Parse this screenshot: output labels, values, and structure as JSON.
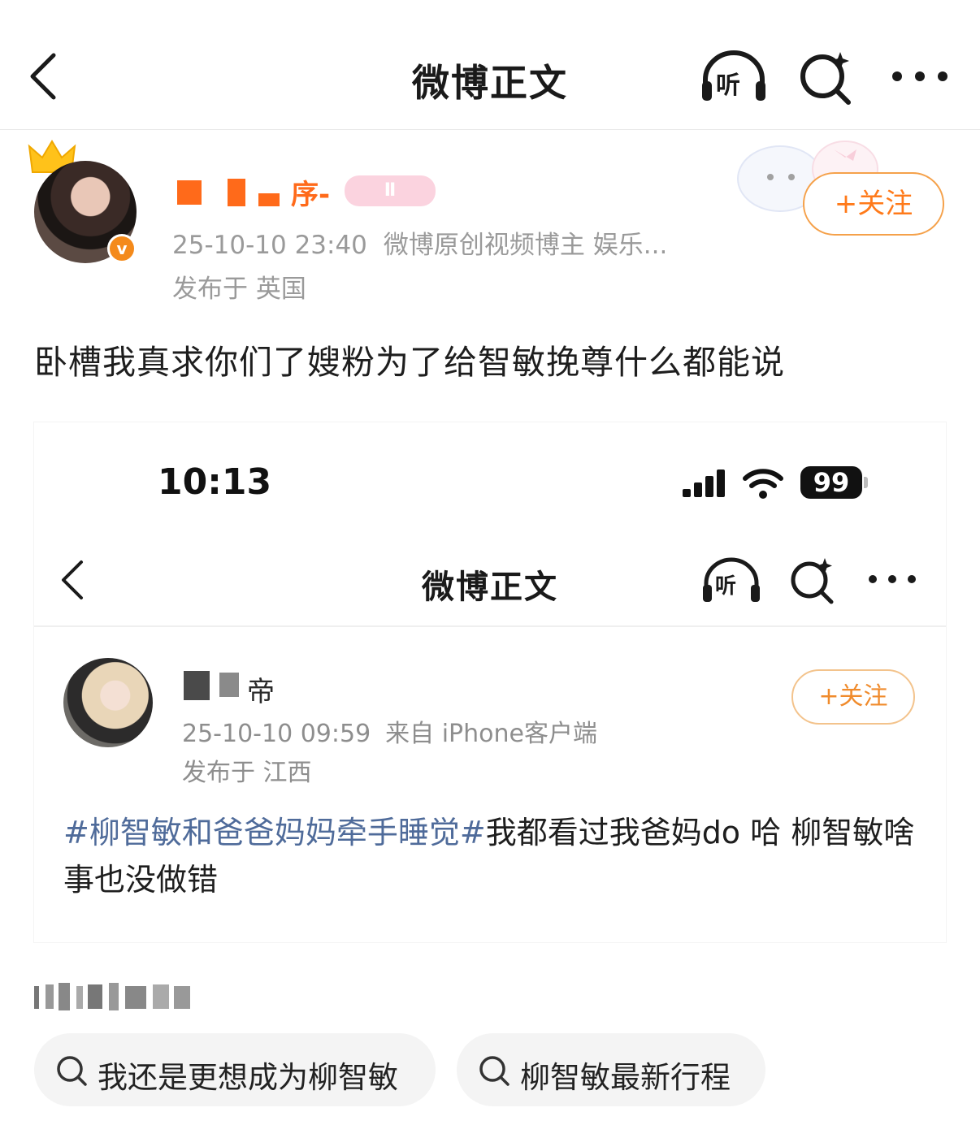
{
  "nav": {
    "title": "微博正文",
    "listen_label": "听"
  },
  "author": {
    "name_suffix": "序-",
    "level_badge": "Ⅱ",
    "verified_badge": "v",
    "time": "25-10-10 23:40",
    "description": "微博原创视频博主 娱乐...",
    "location": "发布于 英国",
    "follow_label": "+关注"
  },
  "post": {
    "text": "卧槽我真求你们了嫂粉为了给智敏挽尊什么都能说"
  },
  "embedded": {
    "status_bar": {
      "time": "10:13",
      "battery": "99"
    },
    "nav": {
      "title": "微博正文",
      "listen_label": "听"
    },
    "author": {
      "name_suffix": "帝",
      "time": "25-10-10 09:59",
      "source": "来自 iPhone客户端",
      "location": "发布于 江西",
      "follow_label": "+关注"
    },
    "post": {
      "hashtag": "#柳智敏和爸爸妈妈牵手睡觉#",
      "text": "我都看过我爸妈do 哈 柳智敏啥事也没做错"
    }
  },
  "related_searches": [
    {
      "label": "我还是更想成为柳智敏"
    },
    {
      "label": "柳智敏最新行程"
    }
  ],
  "colors": {
    "accent_orange": "#ff6a1a",
    "hashtag_blue": "#4f6b9a",
    "meta_gray": "#9a9a9a"
  }
}
